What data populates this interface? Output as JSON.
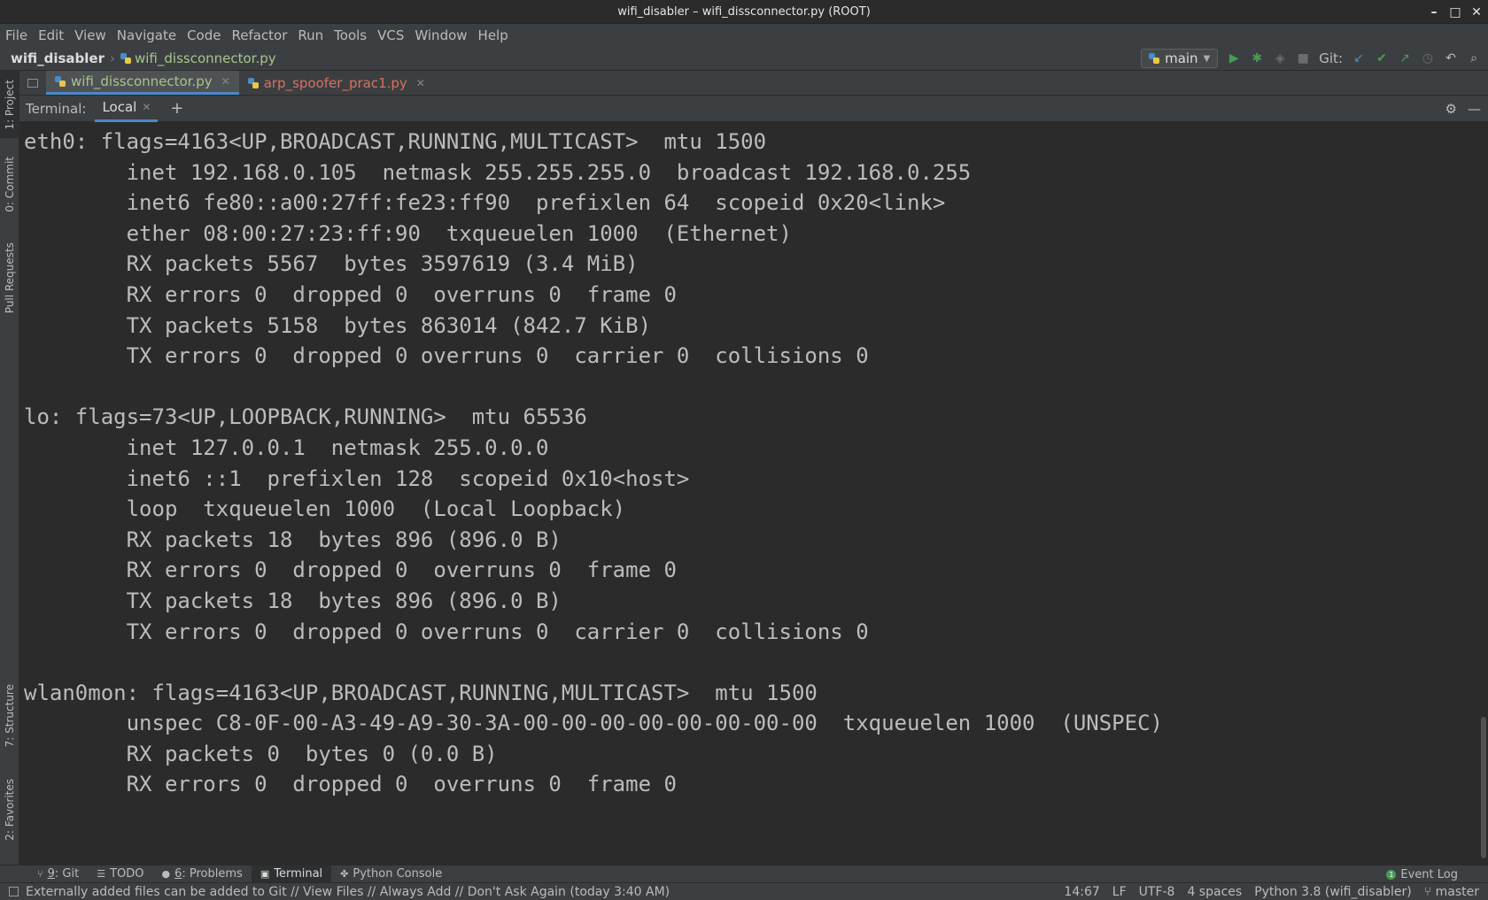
{
  "window": {
    "title": "wifi_disabler – wifi_dissconnector.py (ROOT)",
    "controls": [
      "–",
      "□",
      "✕"
    ]
  },
  "menu": [
    "File",
    "Edit",
    "View",
    "Navigate",
    "Code",
    "Refactor",
    "Run",
    "Tools",
    "VCS",
    "Window",
    "Help"
  ],
  "breadcrumb": {
    "project": "wifi_disabler",
    "file": "wifi_dissconnector.py"
  },
  "toolbar": {
    "run_config": "main",
    "git_label": "Git:"
  },
  "left_tools": [
    "1: Project",
    "0: Commit",
    "Pull Requests",
    "7: Structure",
    "2: Favorites"
  ],
  "editor_tabs": [
    {
      "label": "wifi_dissconnector.py",
      "active": true
    },
    {
      "label": "arp_spoofer_prac1.py",
      "active": false
    }
  ],
  "terminal": {
    "label": "Terminal:",
    "session": "Local",
    "lines": [
      "eth0: flags=4163<UP,BROADCAST,RUNNING,MULTICAST>  mtu 1500",
      "        inet 192.168.0.105  netmask 255.255.255.0  broadcast 192.168.0.255",
      "        inet6 fe80::a00:27ff:fe23:ff90  prefixlen 64  scopeid 0x20<link>",
      "        ether 08:00:27:23:ff:90  txqueuelen 1000  (Ethernet)",
      "        RX packets 5567  bytes 3597619 (3.4 MiB)",
      "        RX errors 0  dropped 0  overruns 0  frame 0",
      "        TX packets 5158  bytes 863014 (842.7 KiB)",
      "        TX errors 0  dropped 0 overruns 0  carrier 0  collisions 0",
      "",
      "lo: flags=73<UP,LOOPBACK,RUNNING>  mtu 65536",
      "        inet 127.0.0.1  netmask 255.0.0.0",
      "        inet6 ::1  prefixlen 128  scopeid 0x10<host>",
      "        loop  txqueuelen 1000  (Local Loopback)",
      "        RX packets 18  bytes 896 (896.0 B)",
      "        RX errors 0  dropped 0  overruns 0  frame 0",
      "        TX packets 18  bytes 896 (896.0 B)",
      "        TX errors 0  dropped 0 overruns 0  carrier 0  collisions 0",
      "",
      "wlan0mon: flags=4163<UP,BROADCAST,RUNNING,MULTICAST>  mtu 1500",
      "        unspec C8-0F-00-A3-49-A9-30-3A-00-00-00-00-00-00-00-00  txqueuelen 1000  (UNSPEC)",
      "        RX packets 0  bytes 0 (0.0 B)",
      "        RX errors 0  dropped 0  overruns 0  frame 0"
    ]
  },
  "bottom_tools": [
    {
      "num": "9",
      "label": ": Git",
      "icon": "branch-icon"
    },
    {
      "num": "",
      "label": "TODO",
      "icon": "list-icon"
    },
    {
      "num": "6",
      "label": ": Problems",
      "icon": "info-icon"
    },
    {
      "num": "",
      "label": "Terminal",
      "icon": "terminal-icon",
      "active": true
    },
    {
      "num": "",
      "label": "Python Console",
      "icon": "python-icon"
    }
  ],
  "event_log": {
    "count": "1",
    "label": "Event Log"
  },
  "status": {
    "message": "Externally added files can be added to Git // View Files // Always Add // Don't Ask Again (today 3:40 AM)",
    "position": "14:67",
    "line_sep": "LF",
    "encoding": "UTF-8",
    "indent": "4 spaces",
    "interpreter": "Python 3.8 (wifi_disabler)",
    "branch": "master"
  },
  "colors": {
    "accent": "#4a88c7",
    "run_green": "#499c54",
    "tab_green": "#a8c48c",
    "tab_red": "#d7705f"
  }
}
